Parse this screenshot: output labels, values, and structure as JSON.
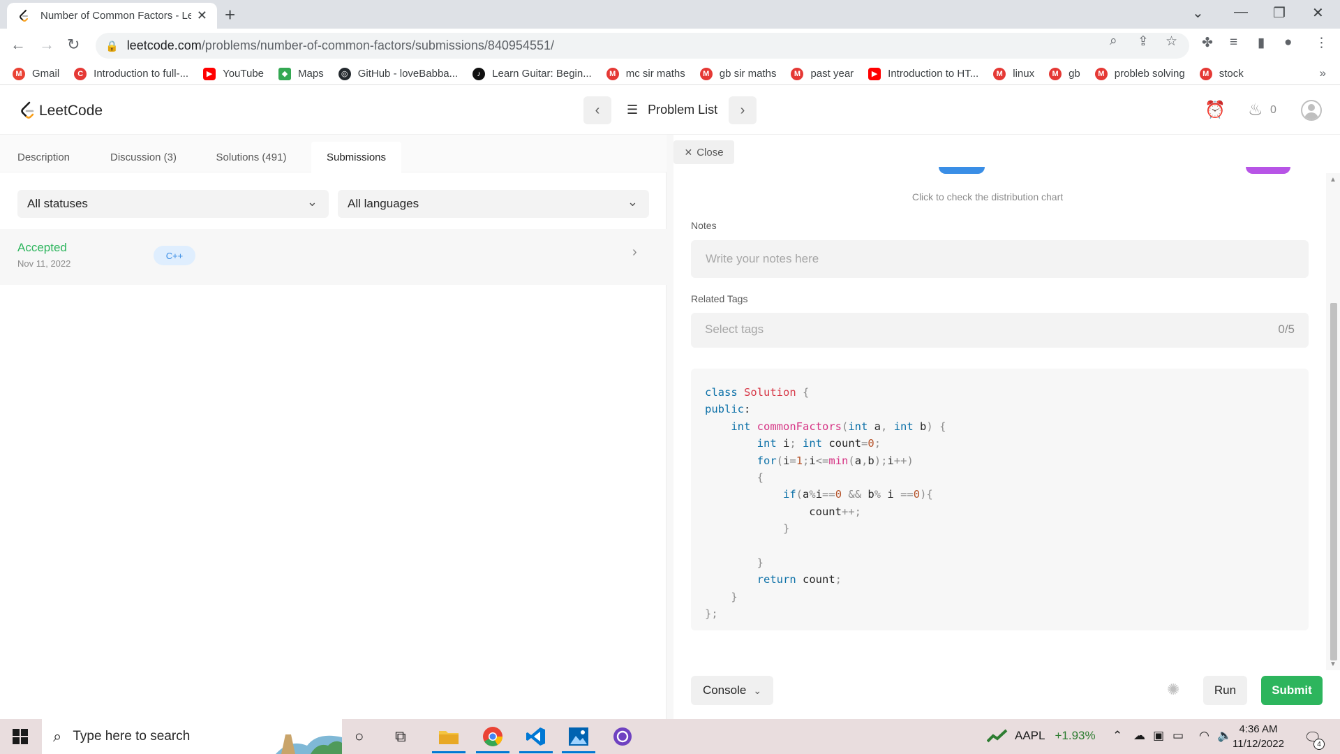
{
  "browser": {
    "tab_title": "Number of Common Factors - Le",
    "url_host": "leetcode.com",
    "url_path": "/problems/number-of-common-factors/submissions/840954551/",
    "bookmarks": [
      {
        "label": "Gmail",
        "icon": "gmail-icon",
        "color": "#ea4335"
      },
      {
        "label": "Introduction to full-...",
        "icon": "c-icon",
        "color": "#e53935"
      },
      {
        "label": "YouTube",
        "icon": "youtube-icon",
        "color": "#ff0000"
      },
      {
        "label": "Maps",
        "icon": "maps-icon",
        "color": "#34a853"
      },
      {
        "label": "GitHub - loveBabba...",
        "icon": "github-icon",
        "color": "#24292e"
      },
      {
        "label": "Learn Guitar: Begin...",
        "icon": "guitar-icon",
        "color": "#111111"
      },
      {
        "label": "mc sir maths",
        "icon": "m-icon",
        "color": "#e53935"
      },
      {
        "label": "gb sir maths",
        "icon": "m-icon",
        "color": "#e53935"
      },
      {
        "label": "past year",
        "icon": "m-icon",
        "color": "#e53935"
      },
      {
        "label": "Introduction to HT...",
        "icon": "youtube-icon",
        "color": "#ff0000"
      },
      {
        "label": "linux",
        "icon": "m-icon",
        "color": "#e53935"
      },
      {
        "label": "gb",
        "icon": "m-icon",
        "color": "#e53935"
      },
      {
        "label": "probleb solving",
        "icon": "m-icon",
        "color": "#e53935"
      },
      {
        "label": "stock",
        "icon": "m-icon",
        "color": "#e53935"
      }
    ]
  },
  "header": {
    "logo_text": "LeetCode",
    "problem_list_label": "Problem List",
    "streak_count": "0"
  },
  "left": {
    "tabs": [
      "Description",
      "Discussion (3)",
      "Solutions (491)",
      "Submissions"
    ],
    "status_filter": "All statuses",
    "language_filter": "All languages",
    "submission": {
      "status": "Accepted",
      "date": "Nov 11, 2022",
      "language": "C++"
    }
  },
  "right": {
    "close_label": "Close",
    "distribution_link": "Click to check the distribution chart",
    "notes_label": "Notes",
    "notes_placeholder": "Write your notes here",
    "tags_label": "Related Tags",
    "tags_placeholder": "Select tags",
    "tags_count": "0/5",
    "code": [
      "class Solution {",
      "public:",
      "    int commonFactors(int a, int b) {",
      "        int i; int count=0;",
      "        for(i=1;i<=min(a,b);i++)",
      "        {",
      "            if(a%i==0 && b% i ==0){",
      "                count++;",
      "            }",
      "",
      "        }",
      "        return count;",
      "    }",
      "};"
    ],
    "console_label": "Console",
    "run_label": "Run",
    "submit_label": "Submit"
  },
  "taskbar": {
    "search_placeholder": "Type here to search",
    "stock_symbol": "AAPL",
    "stock_change": "+1.93%",
    "time": "4:36 AM",
    "date": "11/12/2022",
    "notification_count": "4"
  },
  "colors": {
    "accent_green": "#2db55d",
    "language_badge": "#3a8ee6",
    "taskbar_bg": "#e9ddde"
  }
}
